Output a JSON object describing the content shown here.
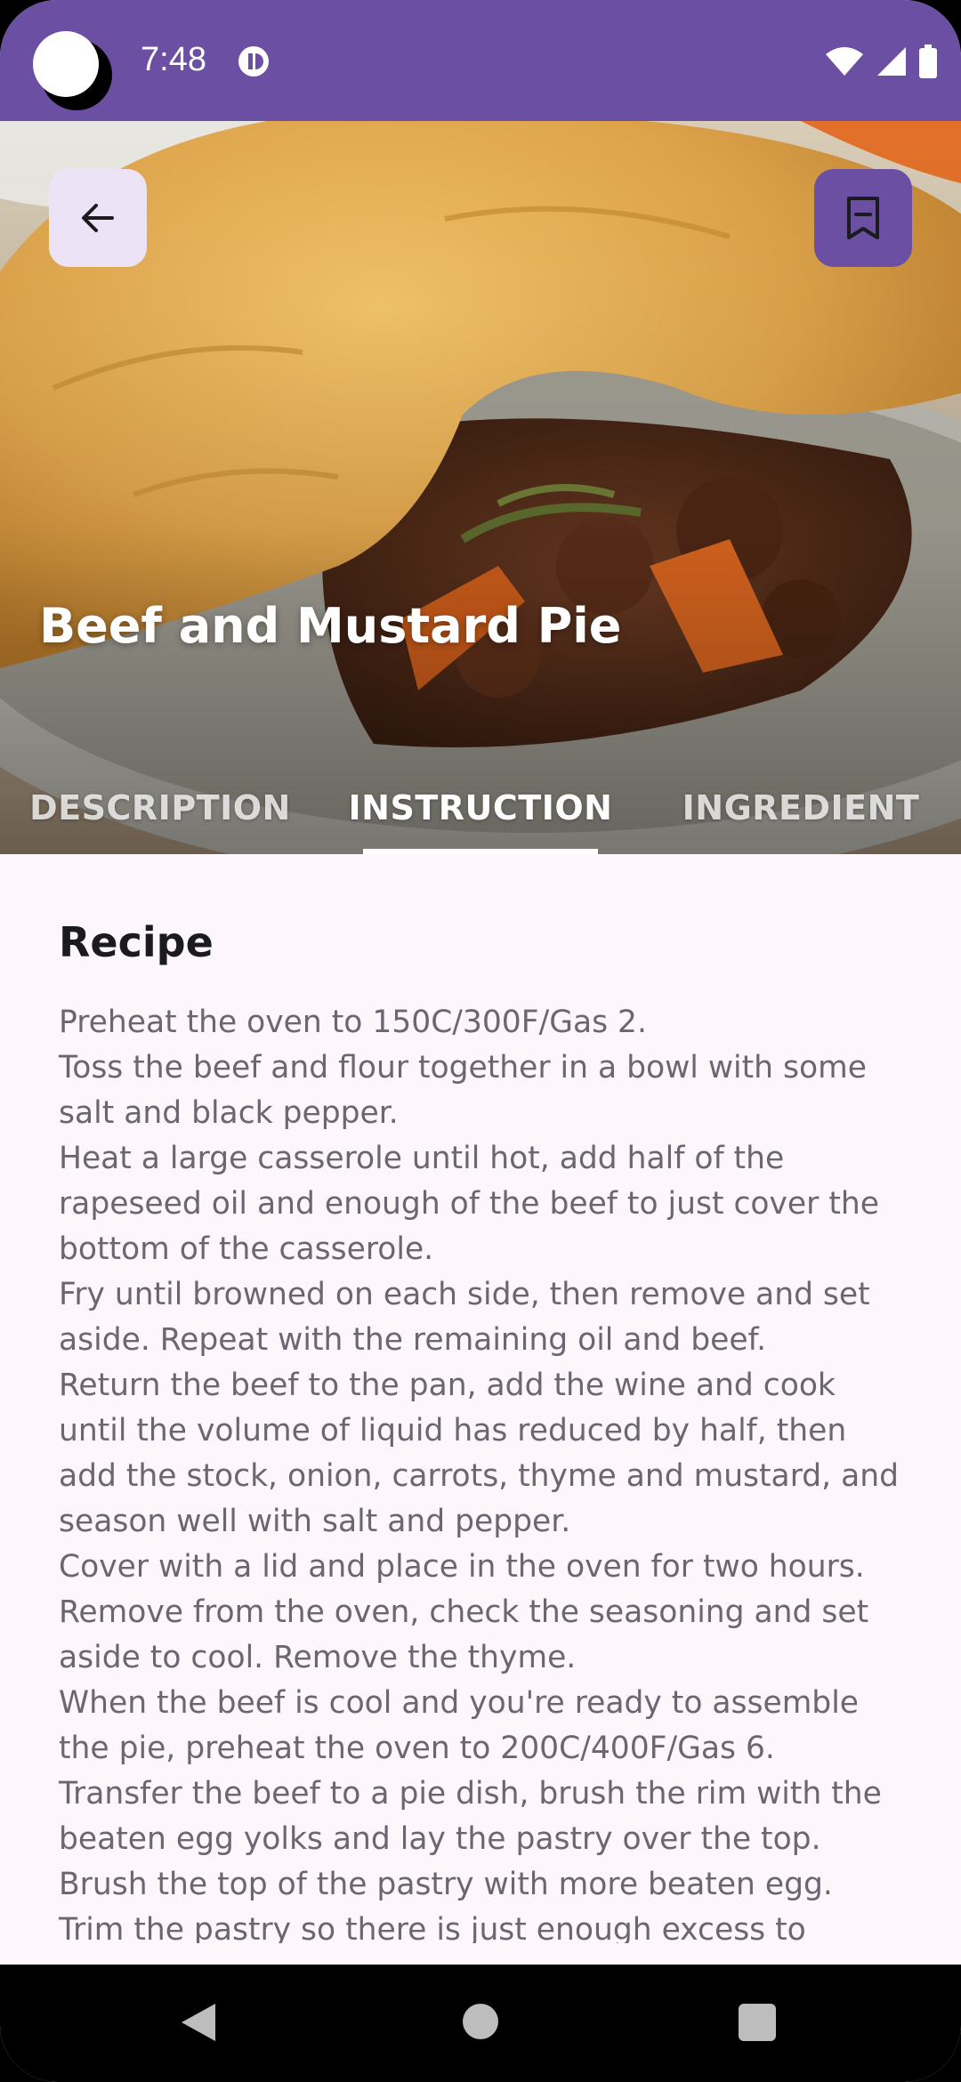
{
  "status_bar": {
    "time": "7:48"
  },
  "header": {
    "back_icon": "arrow-left-icon",
    "bookmark_icon": "bookmark-icon",
    "title": "Beef and Mustard Pie"
  },
  "tabs": [
    {
      "label": "DESCRIPTION",
      "active": false
    },
    {
      "label": "INSTRUCTION",
      "active": true
    },
    {
      "label": "INGREDIENT",
      "active": false
    }
  ],
  "content": {
    "heading": "Recipe",
    "steps": [
      "Preheat the oven to 150C/300F/Gas 2.",
      "Toss the beef and flour together in a bowl with some salt and black pepper.",
      "Heat a large casserole until hot, add half of the rapeseed oil and enough of the beef to just cover the bottom of the casserole.",
      "Fry until browned on each side, then remove and set aside. Repeat with the remaining oil and beef.",
      "Return the beef to the pan, add the wine and cook until the volume of liquid has reduced by half, then add the stock, onion, carrots, thyme and mustard, and season well with salt and pepper.",
      "Cover with a lid and place in the oven for two hours.",
      "Remove from the oven, check the seasoning and set aside to cool. Remove the thyme.",
      "When the beef is cool and you're ready to assemble the pie, preheat the oven to 200C/400F/Gas 6.",
      "Transfer the beef to a pie dish, brush the rim with the beaten egg yolks and lay the pastry over the top.",
      "Brush the top of the pastry with more beaten egg.",
      "Trim the pastry so there is just enough excess to"
    ]
  },
  "colors": {
    "accent": "#6a4fa3",
    "accent_light": "#ece3f7",
    "background": "#fdf7fc",
    "body_text": "#6b6670"
  }
}
